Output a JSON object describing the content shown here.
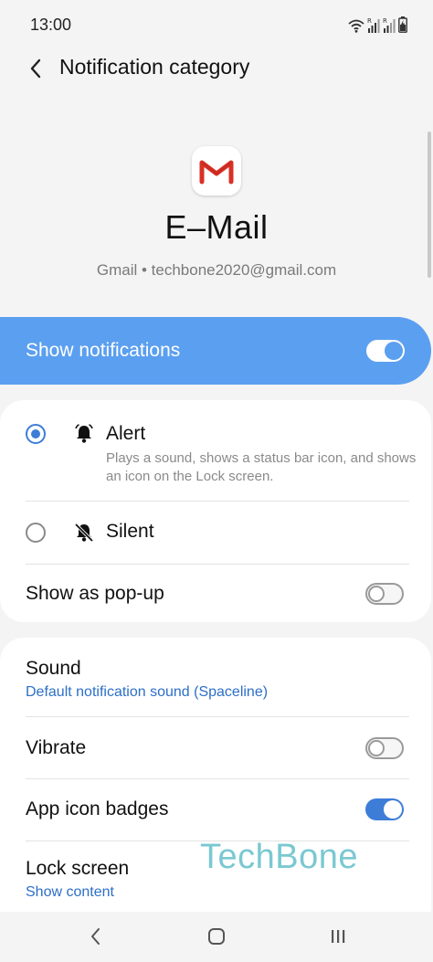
{
  "status_bar": {
    "time": "13:00"
  },
  "header": {
    "title": "Notification category"
  },
  "app": {
    "name": "E–Mail",
    "account": "Gmail • techbone2020@gmail.com",
    "icon": "gmail-icon"
  },
  "show_notifications": {
    "label": "Show notifications",
    "enabled": true
  },
  "notification_type": {
    "alert": {
      "title": "Alert",
      "description": "Plays a sound, shows a status bar icon, and shows an icon on the Lock screen.",
      "selected": true,
      "icon": "bell-icon"
    },
    "silent": {
      "title": "Silent",
      "selected": false,
      "icon": "bell-off-icon"
    },
    "popup": {
      "title": "Show as pop-up",
      "enabled": false
    }
  },
  "settings": {
    "sound": {
      "title": "Sound",
      "value": "Default notification sound (Spaceline)"
    },
    "vibrate": {
      "title": "Vibrate",
      "enabled": false
    },
    "badges": {
      "title": "App icon badges",
      "enabled": true
    },
    "lock_screen": {
      "title": "Lock screen",
      "value": "Show content"
    }
  },
  "watermark": "TechBone",
  "colors": {
    "accent": "#3d7dd8",
    "highlight": "#5b9ff0",
    "background": "#f4f4f4",
    "watermark": "#7ac8d2"
  }
}
